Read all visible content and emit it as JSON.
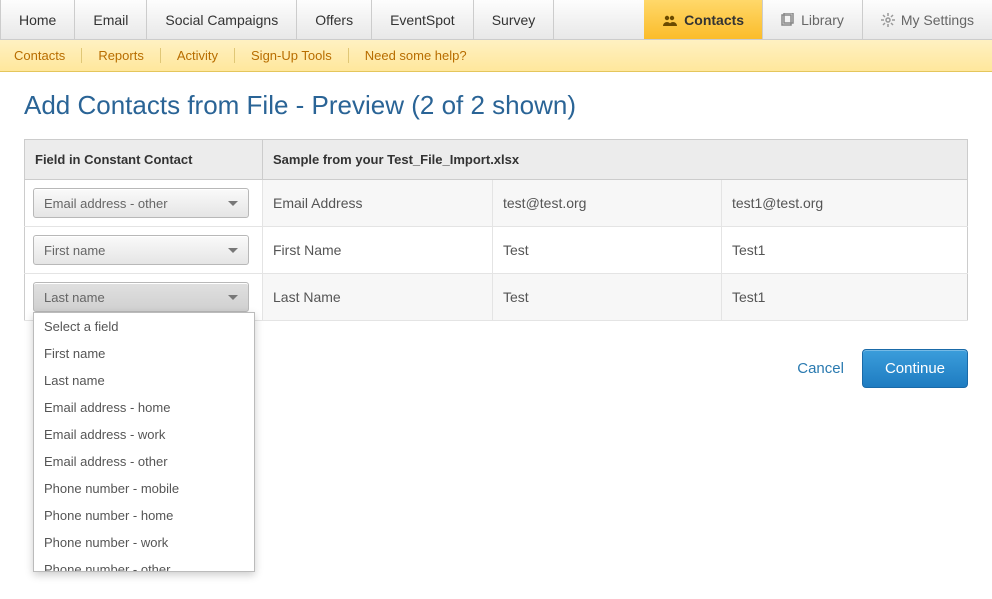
{
  "topnav": {
    "left": [
      "Home",
      "Email",
      "Social Campaigns",
      "Offers",
      "EventSpot",
      "Survey"
    ],
    "right": [
      {
        "label": "Contacts",
        "icon": "people-icon",
        "active": true
      },
      {
        "label": "Library",
        "icon": "library-icon",
        "active": false
      },
      {
        "label": "My Settings",
        "icon": "gear-icon",
        "active": false
      }
    ]
  },
  "subnav": [
    "Contacts",
    "Reports",
    "Activity",
    "Sign-Up Tools",
    "Need some help?"
  ],
  "page_title": "Add Contacts from File - Preview (2 of 2 shown)",
  "table": {
    "header1": "Field in Constant Contact",
    "header2": "Sample from your Test_File_Import.xlsx",
    "rows": [
      {
        "dropdown": "Email address - other",
        "label": "Email Address",
        "s1": "test@test.org",
        "s2": "test1@test.org"
      },
      {
        "dropdown": "First name",
        "label": "First Name",
        "s1": "Test",
        "s2": "Test1"
      },
      {
        "dropdown": "Last name",
        "label": "Last Name",
        "s1": "Test",
        "s2": "Test1"
      }
    ]
  },
  "dropdown_open_index": 2,
  "dropdown_options": [
    "Select a field",
    "First name",
    "Last name",
    "Email address - home",
    "Email address - work",
    "Email address - other",
    "Phone number - mobile",
    "Phone number - home",
    "Phone number - work",
    "Phone number - other"
  ],
  "actions": {
    "cancel": "Cancel",
    "continue": "Continue"
  }
}
